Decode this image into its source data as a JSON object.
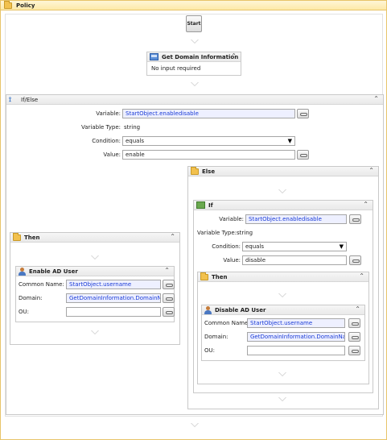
{
  "policy": {
    "title": "Policy"
  },
  "start": {
    "label": "Start"
  },
  "get_domain": {
    "title": "Get Domain Information",
    "body": "No input required"
  },
  "ifelse": {
    "title": "If/Else",
    "variable_label": "Variable:",
    "variable_value": "StartObject.enabledisable",
    "type_label": "Variable Type:",
    "type_value": "string",
    "condition_label": "Condition:",
    "condition_value": "equals",
    "value_label": "Value:",
    "value_value": "enable"
  },
  "then_left": {
    "title": "Then",
    "enable_user": {
      "title": "Enable AD User",
      "common_name_label": "Common Name:",
      "common_name_value": "StartObject.username",
      "domain_label": "Domain:",
      "domain_value": "GetDomainInformation.DomainName",
      "ou_label": "OU:",
      "ou_value": ""
    }
  },
  "else": {
    "title": "Else",
    "if": {
      "title": "If",
      "variable_label": "Variable:",
      "variable_value": "StartObject.enabledisable",
      "type_label": "Variable Type:",
      "type_value": "string",
      "condition_label": "Condition:",
      "condition_value": "equals",
      "value_label": "Value:",
      "value_value": "disable"
    },
    "then": {
      "title": "Then",
      "disable_user": {
        "title": "Disable AD User",
        "common_name_label": "Common Name:",
        "common_name_value": "StartObject.username",
        "domain_label": "Domain:",
        "domain_value": "GetDomainInformation.DomainName",
        "ou_label": "OU:",
        "ou_value": ""
      }
    }
  },
  "icons": {
    "collapse": "chevron-up-icon",
    "folder": "folder-icon",
    "user": "user-icon",
    "server": "server-icon"
  }
}
